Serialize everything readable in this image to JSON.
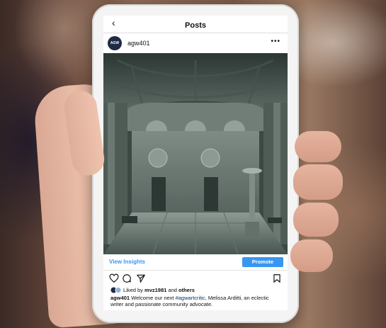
{
  "header": {
    "back_icon": "chevron-left-icon",
    "title": "Posts"
  },
  "post": {
    "username": "agw401",
    "avatar_text": "AGW",
    "more_icon": "more-horizontal-icon"
  },
  "insights": {
    "view_label": "View Insights",
    "promote_label": "Promote"
  },
  "actions": {
    "icons": [
      "heart-icon",
      "comment-icon",
      "share-icon",
      "bookmark-icon"
    ]
  },
  "likes": {
    "prefix": "Liked by ",
    "user": "mvz1981",
    "middle": " and ",
    "suffix": "others"
  },
  "caption": {
    "username": "agw401",
    "text_before": " Welcome our next ",
    "hashtag": "#agwartcritic",
    "text_after": ", Melissa Arditti, an eclectic writer and passionate community advocate."
  },
  "colors": {
    "accent": "#3897f0",
    "hashtag": "#003569"
  }
}
